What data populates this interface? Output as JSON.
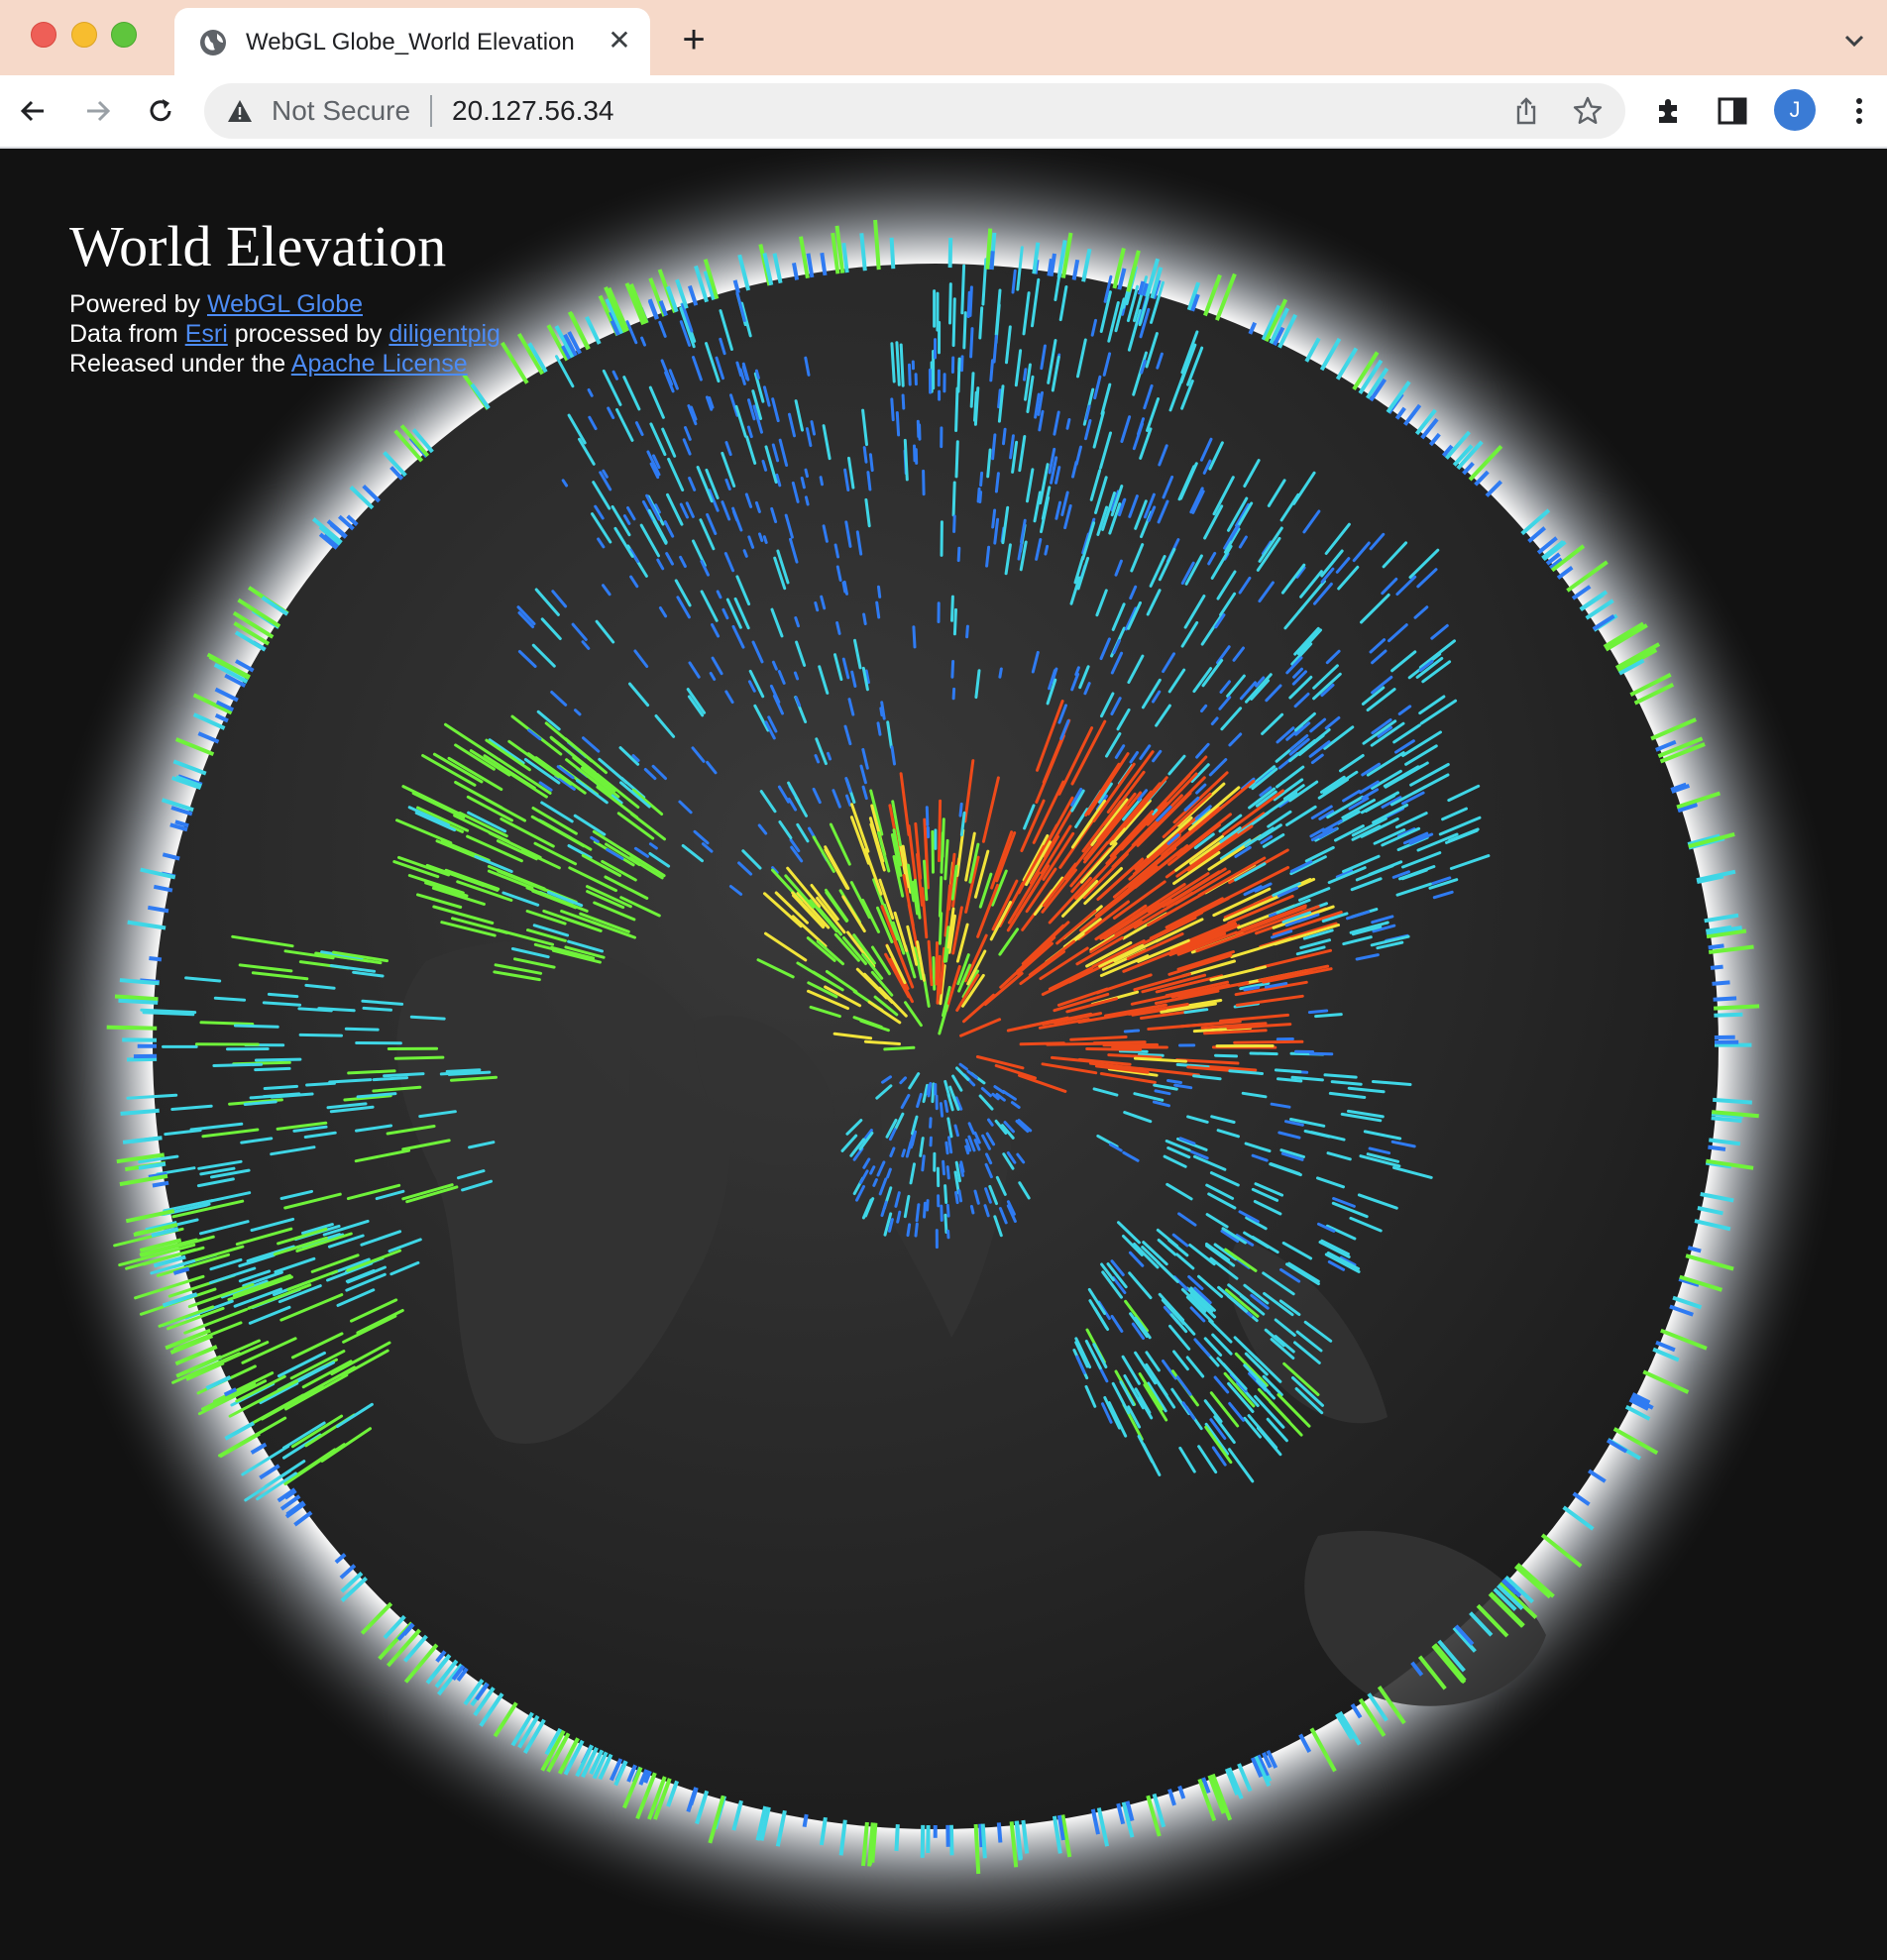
{
  "window": {
    "tab_title": "WebGL Globe_World Elevation",
    "new_tab_label": "+"
  },
  "toolbar": {
    "security_label": "Not Secure",
    "url": "20.127.56.34",
    "profile_initial": "J"
  },
  "page": {
    "title": "World Elevation",
    "powered_prefix": "Powered by ",
    "powered_link": "WebGL Globe",
    "data_prefix": "Data from ",
    "data_link": "Esri",
    "processed_text": " processed by ",
    "processed_link": "diligentpig",
    "license_prefix": "Released under the ",
    "license_link": "Apache License"
  },
  "colors": {
    "low": "#2f7bf2",
    "mid_low": "#3fd6e6",
    "mid": "#6ff23a",
    "mid_high": "#f2e43a",
    "high": "#ee4a1a",
    "background": "#121212",
    "link": "#4d8cf5"
  }
}
